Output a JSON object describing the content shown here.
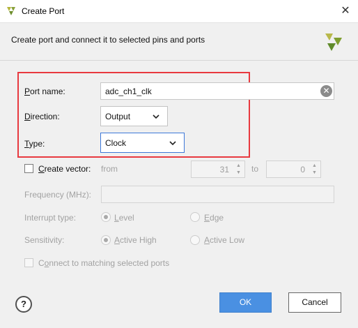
{
  "window": {
    "title": "Create Port",
    "close_glyph": "✕"
  },
  "header": {
    "description": "Create port and connect it to selected pins and ports",
    "logo": "vivado-logo-icon"
  },
  "form": {
    "port_name": {
      "label_underline": "P",
      "label_rest": "ort name:",
      "value": "adc_ch1_clk",
      "clear_glyph": "✕"
    },
    "direction": {
      "label_underline": "D",
      "label_rest": "irection:",
      "value": "Output"
    },
    "type": {
      "label_underline": "T",
      "label_rest": "ype:",
      "value": "Clock"
    },
    "create_vector": {
      "label_underline": "C",
      "label_rest": "reate vector:",
      "checked": false,
      "from_label": "from",
      "from_value": "31",
      "to_label": "to",
      "to_value": "0"
    },
    "frequency": {
      "label": "Frequency (MHz):",
      "value": ""
    },
    "interrupt_type": {
      "label": "Interrupt type:",
      "options": [
        {
          "underline": "L",
          "rest": "evel",
          "selected": true
        },
        {
          "underline": "E",
          "rest": "dge",
          "selected": false
        }
      ]
    },
    "sensitivity": {
      "label": "Sensitivity:",
      "options": [
        {
          "underline": "A",
          "rest": "ctive High",
          "selected": true
        },
        {
          "underline": "A",
          "rest": "ctive Low",
          "selected": false
        }
      ]
    },
    "connect_matching": {
      "label_prefix": "C",
      "label_underline": "o",
      "label_rest": "nnect to matching selected ports",
      "checked": false
    }
  },
  "footer": {
    "help_label": "?",
    "ok_label": "OK",
    "cancel_label": "Cancel"
  },
  "colors": {
    "highlight": "#e8393f",
    "ok_button": "#4a90e2",
    "focus": "#3c78d8"
  }
}
